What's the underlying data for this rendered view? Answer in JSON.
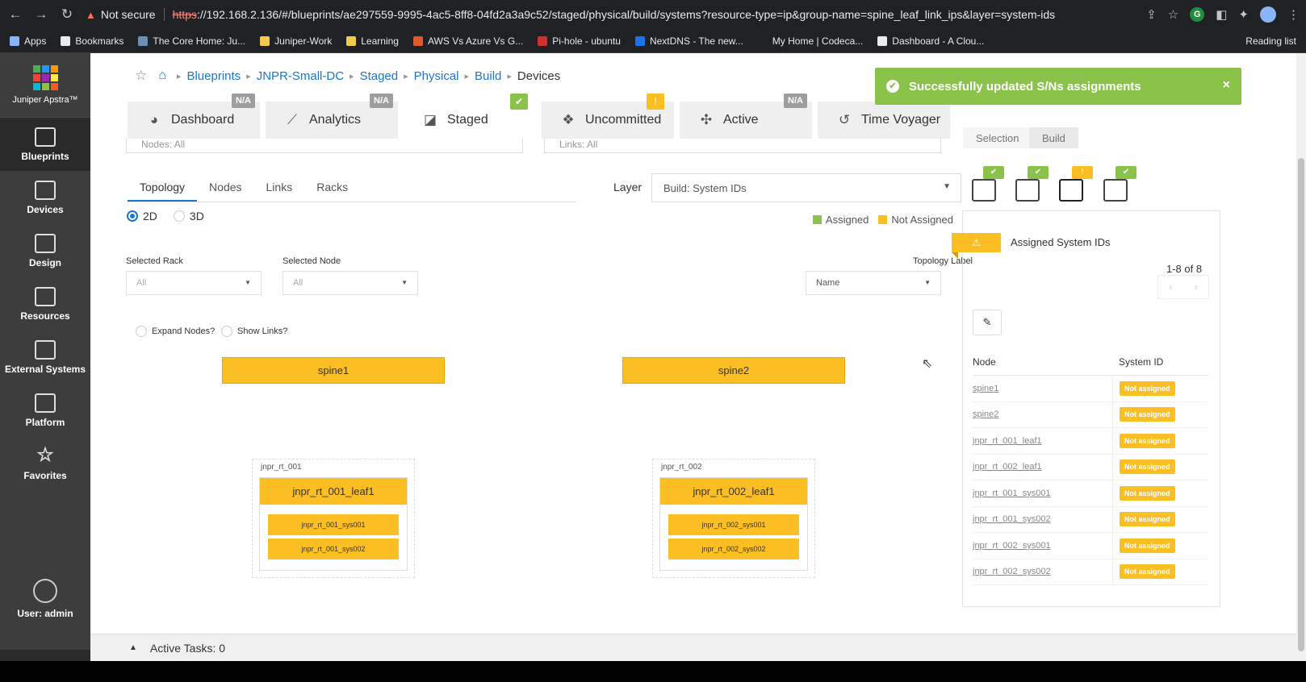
{
  "browser": {
    "not_secure": "Not secure",
    "url_proto": "https",
    "url_rest": "://192.168.2.136/#/blueprints/ae297559-9995-4ac5-8ff8-04fd2a3a9c52/staged/physical/build/systems?resource-type=ip&group-name=spine_leaf_link_ips&layer=system-ids",
    "bookmarks": [
      {
        "label": "Apps",
        "color": "#8ab4f8"
      },
      {
        "label": "Bookmarks",
        "color": "#e8eaed"
      },
      {
        "label": "The Core Home: Ju...",
        "color": "#6b8eb3"
      },
      {
        "label": "Juniper-Work",
        "color": "#f2c94c"
      },
      {
        "label": "Learning",
        "color": "#f2c94c"
      },
      {
        "label": "AWS Vs Azure Vs G...",
        "color": "#e05a2b"
      },
      {
        "label": "Pi-hole - ubuntu",
        "color": "#d32f2f"
      },
      {
        "label": "NextDNS - The new...",
        "color": "#1a73e8"
      },
      {
        "label": "My Home | Codeca...",
        "color": "#202124"
      },
      {
        "label": "Dashboard - A Clou...",
        "color": "#e8eaed"
      }
    ],
    "reading_list": "Reading list"
  },
  "sidebar": {
    "logo_text": "Juniper Apstra™",
    "items": [
      {
        "label": "Blueprints"
      },
      {
        "label": "Devices"
      },
      {
        "label": "Design"
      },
      {
        "label": "Resources"
      },
      {
        "label": "External Systems"
      },
      {
        "label": "Platform"
      },
      {
        "label": "Favorites"
      }
    ],
    "user": "User: admin"
  },
  "breadcrumb": [
    "Blueprints",
    "JNPR-Small-DC",
    "Staged",
    "Physical",
    "Build",
    "Devices"
  ],
  "tabs": [
    {
      "label": "Dashboard",
      "badge": "N/A"
    },
    {
      "label": "Analytics",
      "badge": "N/A"
    },
    {
      "label": "Staged",
      "badge": "✔"
    },
    {
      "label": "Uncommitted",
      "badge": "!"
    },
    {
      "label": "Active",
      "badge": "N/A"
    },
    {
      "label": "Time Voyager",
      "badge": ""
    }
  ],
  "filters": {
    "nodes": "Nodes: All",
    "links": "Links: All"
  },
  "toast": {
    "message": "Successfully updated S/Ns assignments",
    "close": "×",
    "color": "#8bc34a"
  },
  "subtabs": [
    "Topology",
    "Nodes",
    "Links",
    "Racks"
  ],
  "layer": {
    "label": "Layer",
    "value": "Build: System IDs"
  },
  "view_mode": {
    "opt2d": "2D",
    "opt3d": "3D"
  },
  "legend": {
    "assigned": "Assigned",
    "not_assigned": "Not Assigned",
    "assigned_color": "#8bc34a",
    "not_assigned_color": "#fbbf24"
  },
  "controls": {
    "selected_rack_label": "Selected Rack",
    "selected_rack_value": "All",
    "selected_node_label": "Selected Node",
    "selected_node_value": "All",
    "topology_label_label": "Topology Label",
    "topology_label_value": "Name",
    "expand_nodes": "Expand Nodes?",
    "show_links": "Show Links?"
  },
  "topology": {
    "spines": [
      "spine1",
      "spine2"
    ],
    "racks": [
      {
        "name": "jnpr_rt_001",
        "leaf": "jnpr_rt_001_leaf1",
        "systems": [
          "jnpr_rt_001_sys001",
          "jnpr_rt_001_sys002"
        ]
      },
      {
        "name": "jnpr_rt_002",
        "leaf": "jnpr_rt_002_leaf1",
        "systems": [
          "jnpr_rt_002_sys001",
          "jnpr_rt_002_sys002"
        ]
      }
    ]
  },
  "right_panel": {
    "tabs": [
      "Selection",
      "Build"
    ],
    "title": "Assigned System IDs",
    "pager": "1-8 of 8",
    "col_node": "Node",
    "col_system_id": "System ID",
    "rows": [
      {
        "node": "spine1",
        "system_id": "Not assigned"
      },
      {
        "node": "spine2",
        "system_id": "Not assigned"
      },
      {
        "node": "jnpr_rt_001_leaf1",
        "system_id": "Not assigned"
      },
      {
        "node": "jnpr_rt_002_leaf1",
        "system_id": "Not assigned"
      },
      {
        "node": "jnpr_rt_001_sys001",
        "system_id": "Not assigned"
      },
      {
        "node": "jnpr_rt_001_sys002",
        "system_id": "Not assigned"
      },
      {
        "node": "jnpr_rt_002_sys001",
        "system_id": "Not assigned"
      },
      {
        "node": "jnpr_rt_002_sys002",
        "system_id": "Not assigned"
      }
    ]
  },
  "active_tasks": "Active Tasks: 0"
}
